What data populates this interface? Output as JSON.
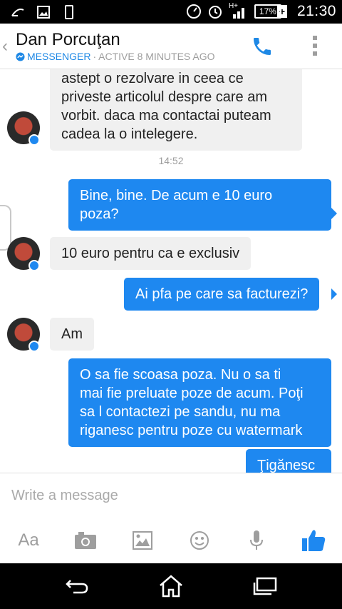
{
  "status_bar": {
    "time": "21:30",
    "battery": "17%",
    "network": "H+",
    "icons": [
      "launcher-icon",
      "gallery-icon",
      "phone-icon",
      "speed-icon",
      "alarm-icon",
      "signal-icon",
      "battery-icon"
    ]
  },
  "header": {
    "contact_name": "Dan Porcuţan",
    "app_label": "MESSENGER",
    "separator": "·",
    "status": "ACTIVE 8 MINUTES AGO",
    "back_icon": "chevron-left-icon",
    "call_icon": "phone-icon",
    "more_icon": "more-vert-icon"
  },
  "conversation": {
    "messages": [
      {
        "from": "contact",
        "lines": [
          "astept o rezolvare in ceea ce",
          "priveste articolul despre care am",
          "vorbit. daca ma contactai puteam",
          "cadea la o intelegere."
        ]
      },
      {
        "timestamp": "14:52"
      },
      {
        "from": "me",
        "lines": [
          "Bine, bine. De acum e 10 euro",
          "poza?"
        ]
      },
      {
        "from": "contact",
        "lines": [
          "10 euro pentru ca e exclusiv"
        ]
      },
      {
        "from": "me",
        "lines": [
          "Ai pfa pe care sa facturezi?"
        ]
      },
      {
        "from": "contact",
        "lines": [
          "Am"
        ]
      },
      {
        "from": "me",
        "lines": [
          "O sa fie scoasa poza. Nu o sa ti",
          "mai fie preluate poze de acum. Poţi",
          "sa l contactezi pe sandu, nu ma",
          "riganesc pentru poze cu watermark"
        ]
      },
      {
        "from": "me",
        "lines": [
          "Ţigănesc"
        ]
      }
    ]
  },
  "composer": {
    "placeholder": "Write a message",
    "text_tool": "Aa",
    "tools": [
      "text-format-icon",
      "camera-icon",
      "image-icon",
      "emoji-icon",
      "microphone-icon",
      "like-icon"
    ],
    "accent": "#1e88f0"
  },
  "nav_bar": {
    "icons": [
      "back-icon",
      "home-icon",
      "recent-apps-icon"
    ]
  }
}
